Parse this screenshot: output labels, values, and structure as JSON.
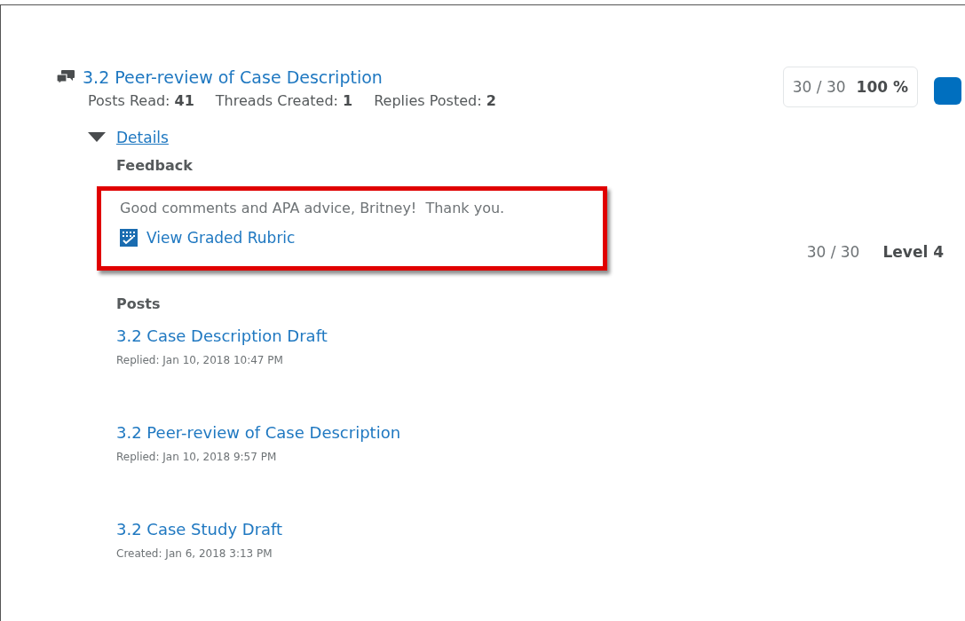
{
  "topic": {
    "title": "3.2 Peer-review of Case Description",
    "stats": [
      "Posts Read: **41**",
      "Threads Created: **1**",
      "Replies Posted: **2**"
    ],
    "score": {
      "points": "30 / 30",
      "percent": "100 %"
    }
  },
  "details": {
    "label": "Details",
    "expanded": true,
    "feedback": {
      "heading": "Feedback",
      "text": "Good comments and APA advice, Britney!  Thank you.",
      "highlighted": true,
      "rubric_link": "View Graded Rubric",
      "rubric_points": "30 / 30",
      "rubric_level": "Level 4"
    },
    "posts_heading": "Posts",
    "posts": [
      {
        "title": "3.2 Case Description Draft",
        "meta": "Replied: Jan 10, 2018 10:47 PM"
      },
      {
        "title": "3.2 Peer-review of Case Description",
        "meta": "Replied: Jan 10, 2018 9:57 PM"
      },
      {
        "title": "3.2 Case Study Draft",
        "meta": "Created: Jan 6, 2018 3:13 PM"
      }
    ]
  }
}
